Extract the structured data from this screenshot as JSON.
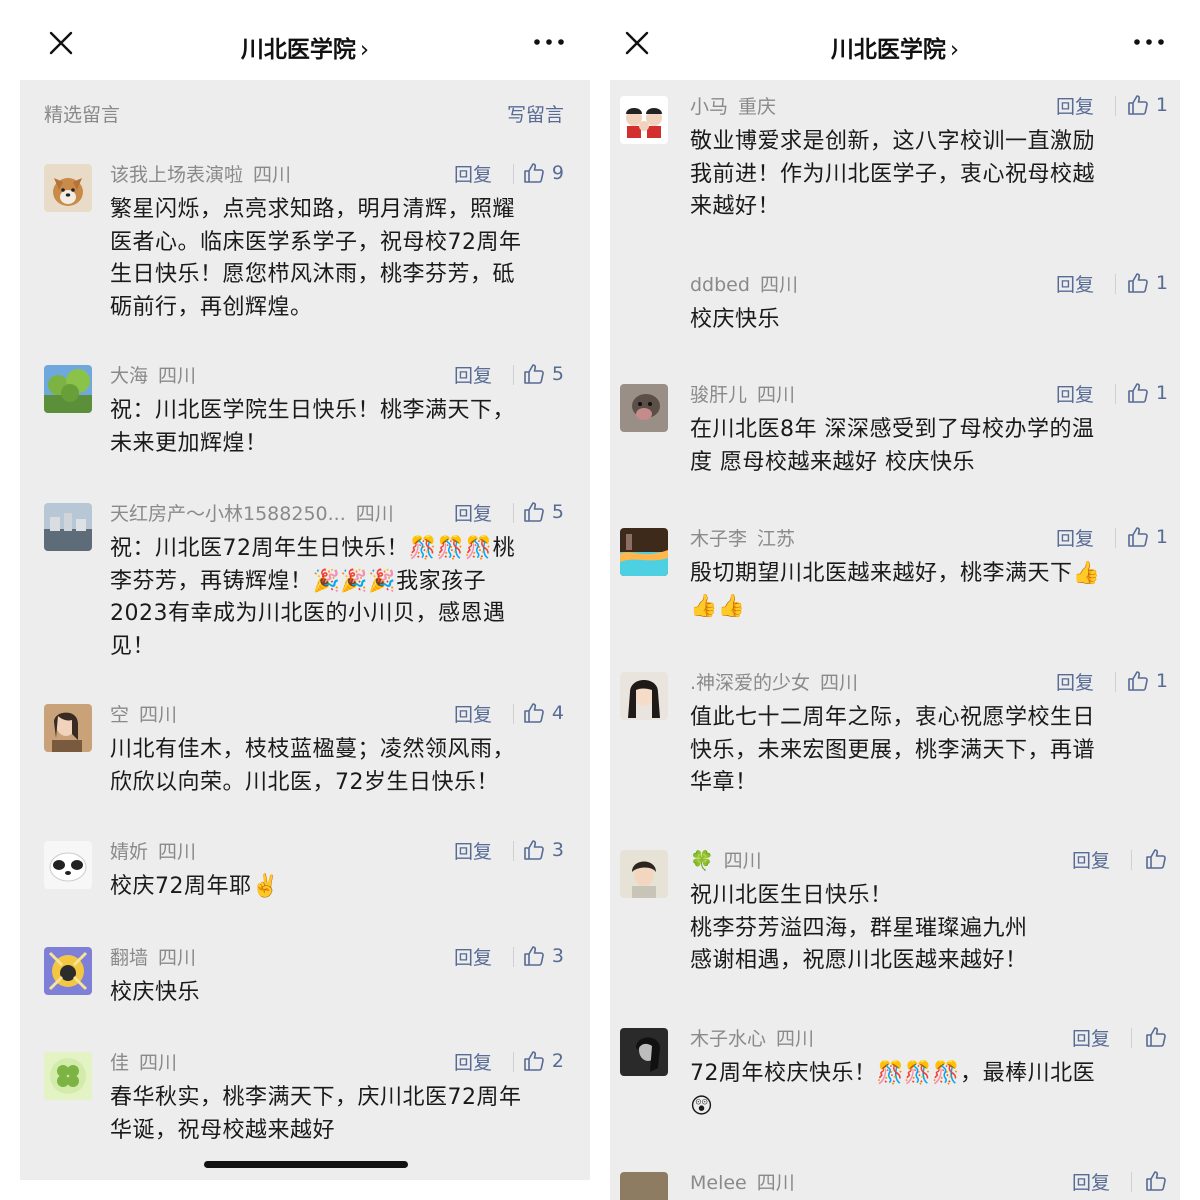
{
  "left": {
    "title": "川北医学院",
    "title_chevron": "›",
    "section_label": "精选留言",
    "write_label": "写留言",
    "comments": [
      {
        "name": "该我上场表演啦",
        "loc": "四川",
        "reply": "回复",
        "likes": "9",
        "lines": [
          "繁星闪烁，点亮求知路，明月清辉，照耀",
          "医者心。临床医学系学子，祝母校72周年",
          "生日快乐！愿您栉风沐雨，桃李芬芳，砥",
          "砺前行，再创辉煌。"
        ]
      },
      {
        "name": "大海",
        "loc": "四川",
        "reply": "回复",
        "likes": "5",
        "lines": [
          "祝：川北医学院生日快乐！桃李满天下，",
          "未来更加辉煌！"
        ]
      },
      {
        "name": "天红房产～小林1588250...",
        "loc": "四川",
        "reply": "回复",
        "likes": "5",
        "lines": [
          "祝：川北医72周年生日快乐！🎊🎊🎊桃",
          "李芬芳，再铸辉煌！🎉🎉🎉我家孩子",
          "2023有幸成为川北医的小川贝，感恩遇",
          "见！"
        ]
      },
      {
        "name": "空",
        "loc": "四川",
        "reply": "回复",
        "likes": "4",
        "lines": [
          "川北有佳木，枝枝蓝楹蔓；凌然领风雨，",
          "欣欣以向荣。川北医，72岁生日快乐！"
        ]
      },
      {
        "name": "婧妡",
        "loc": "四川",
        "reply": "回复",
        "likes": "3",
        "lines": [
          "校庆72周年耶✌️"
        ]
      },
      {
        "name": "翻墙",
        "loc": "四川",
        "reply": "回复",
        "likes": "3",
        "lines": [
          "校庆快乐"
        ]
      },
      {
        "name": "佳",
        "loc": "四川",
        "reply": "回复",
        "likes": "2",
        "lines": [
          "春华秋实，桃李满天下，庆川北医72周年",
          "华诞，祝母校越来越好"
        ]
      }
    ]
  },
  "right": {
    "title": "川北医学院",
    "title_chevron": "›",
    "comments": [
      {
        "name": "小马",
        "loc": "重庆",
        "reply": "回复",
        "likes": "1",
        "lines": [
          "敬业博爱求是创新，这八字校训一直激励",
          "我前进！作为川北医学子，衷心祝母校越",
          "来越好！"
        ]
      },
      {
        "name": "ddbed",
        "loc": "四川",
        "reply": "回复",
        "likes": "1",
        "lines": [
          "校庆快乐"
        ]
      },
      {
        "name": "骏肝儿",
        "loc": "四川",
        "reply": "回复",
        "likes": "1",
        "lines": [
          "在川北医8年  深深感受到了母校办学的温",
          "度  愿母校越来越好  校庆快乐"
        ]
      },
      {
        "name": "木子李",
        "loc": "江苏",
        "reply": "回复",
        "likes": "1",
        "lines": [
          "殷切期望川北医越来越好，桃李满天下👍",
          "👍👍"
        ]
      },
      {
        "name": ".神深爱的少女",
        "loc": "四川",
        "reply": "回复",
        "likes": "1",
        "lines": [
          "值此七十二周年之际，衷心祝愿学校生日",
          "快乐，未来宏图更展，桃李满天下，再谱",
          "华章！"
        ]
      },
      {
        "name": "🍀",
        "loc": "四川",
        "reply": "回复",
        "likes": "",
        "lines": [
          "祝川北医生日快乐！",
          "桃李芬芳溢四海，群星璀璨遍九州",
          "感谢相遇，祝愿川北医越来越好！"
        ]
      },
      {
        "name": "木子水心",
        "loc": "四川",
        "reply": "回复",
        "likes": "",
        "lines": [
          "72周年校庆快乐！🎊🎊🎊，最棒川北医",
          "😲"
        ]
      },
      {
        "name": "Melee",
        "loc": "四川",
        "reply": "回复",
        "likes": "",
        "lines": []
      }
    ]
  }
}
